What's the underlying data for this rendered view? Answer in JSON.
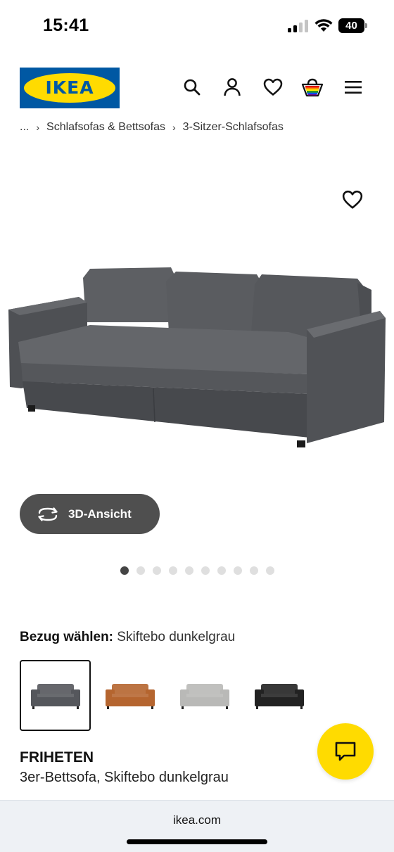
{
  "status_bar": {
    "time": "15:41",
    "battery_level": "40"
  },
  "header": {
    "logo_text": "IKEA",
    "icons": [
      "search-icon",
      "account-icon",
      "wishlist-icon",
      "cart-icon",
      "menu-icon"
    ]
  },
  "breadcrumb": {
    "items": [
      "...",
      "Schlafsofas & Bettsofas",
      "3-Sitzer-Schlafsofas"
    ]
  },
  "product": {
    "view_3d_label": "3D-Ansicht",
    "image_count": 10,
    "active_image_index": 0,
    "cover_label": "Bezug wählen:",
    "cover_value": "Skiftebo dunkelgrau",
    "name": "FRIHETEN",
    "description": "3er-Bettsofa, Skiftebo dunkelgrau"
  },
  "swatches": [
    {
      "color": "#55575c",
      "selected": true
    },
    {
      "color": "#b5652f",
      "selected": false
    },
    {
      "color": "#b9b9b7",
      "selected": false
    },
    {
      "color": "#222222",
      "selected": false
    }
  ],
  "browser": {
    "url": "ikea.com"
  },
  "colors": {
    "ikea_blue": "#0058a3",
    "ikea_yellow": "#ffdb00",
    "sofa_grey": "#55575c"
  }
}
